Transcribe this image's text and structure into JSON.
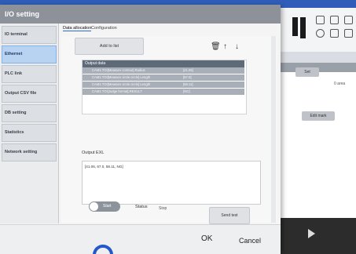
{
  "dialog": {
    "title": "I/O setting",
    "sidebar": [
      {
        "label": "IO terminal",
        "active": false
      },
      {
        "label": "Ethernet",
        "active": true
      },
      {
        "label": "PLC link",
        "active": false
      },
      {
        "label": "Output CSV file",
        "active": false
      },
      {
        "label": "DB setting",
        "active": false
      },
      {
        "label": "Statistics",
        "active": false
      },
      {
        "label": "Network setting",
        "active": false
      }
    ],
    "tabs": [
      "Data allocation",
      "Configuration"
    ],
    "add_button": "Add to list",
    "table": {
      "header": "Output data",
      "rows": [
        {
          "name": "CAM1.TOI[Measure contour].Radius",
          "value": "[41.06]"
        },
        {
          "name": "CAM1.TOI[Measure circle circle].Length",
          "value": "[67.0]"
        },
        {
          "name": "CAM1.TOI[Measure circle circle].Length",
          "value": "[58.11]"
        },
        {
          "name": "CAM1.TOI[Judge format].RESULT",
          "value": "[NG]"
        }
      ]
    },
    "output_label": "Output EXL",
    "output_text": "[41.06, 67.0, 58.11, NG]",
    "toggle_label": "Start",
    "status_label": "Status",
    "status_value": "Stop",
    "send_button": "Send test",
    "ok_button": "OK",
    "cancel_button": "Cancel"
  },
  "background": {
    "header_text": "",
    "button1": "Set",
    "button2": "Edit mark",
    "side_text": "0 area"
  },
  "colors": {
    "accent": "#2f5db8",
    "title_bar": "#8c919a",
    "active_item": "#b7d3f1"
  },
  "icons": [
    "delete-icon",
    "arrow-up-icon",
    "arrow-down-icon",
    "play-icon"
  ]
}
